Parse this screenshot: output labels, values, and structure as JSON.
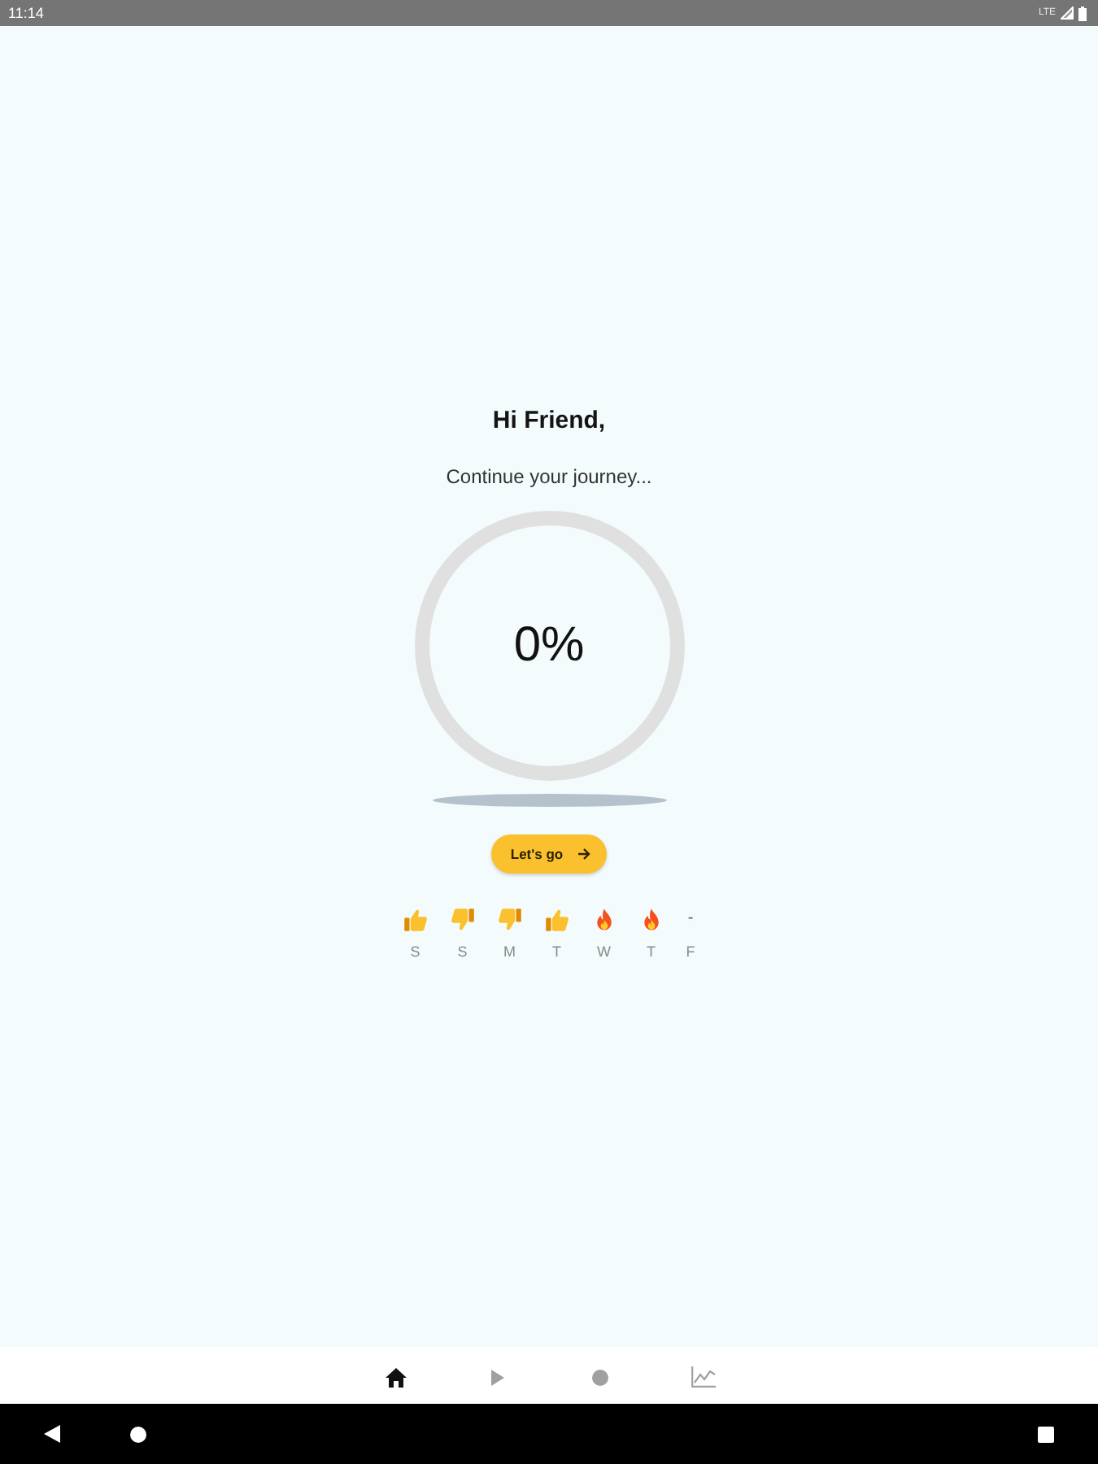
{
  "status_bar": {
    "time": "11:14",
    "network": "LTE"
  },
  "greeting": {
    "title": "Hi Friend,",
    "subtitle": "Continue your journey..."
  },
  "progress": {
    "reading": "0%"
  },
  "cta_button": {
    "label": "Let's go"
  },
  "week": [
    {
      "day": "S",
      "kind": "thumbs-up"
    },
    {
      "day": "S",
      "kind": "thumbs-down"
    },
    {
      "day": "M",
      "kind": "thumbs-down"
    },
    {
      "day": "T",
      "kind": "thumbs-up"
    },
    {
      "day": "W",
      "kind": "fire"
    },
    {
      "day": "T",
      "kind": "fire"
    },
    {
      "day": "F",
      "kind": "none",
      "mark": "-"
    }
  ],
  "bottom_nav": [
    {
      "kind": "home",
      "selected": true
    },
    {
      "kind": "play",
      "selected": false
    },
    {
      "kind": "record",
      "selected": false
    },
    {
      "kind": "chart",
      "selected": false
    }
  ],
  "system_nav": [
    {
      "kind": "back"
    },
    {
      "kind": "home"
    },
    {
      "kind": "recents"
    }
  ]
}
